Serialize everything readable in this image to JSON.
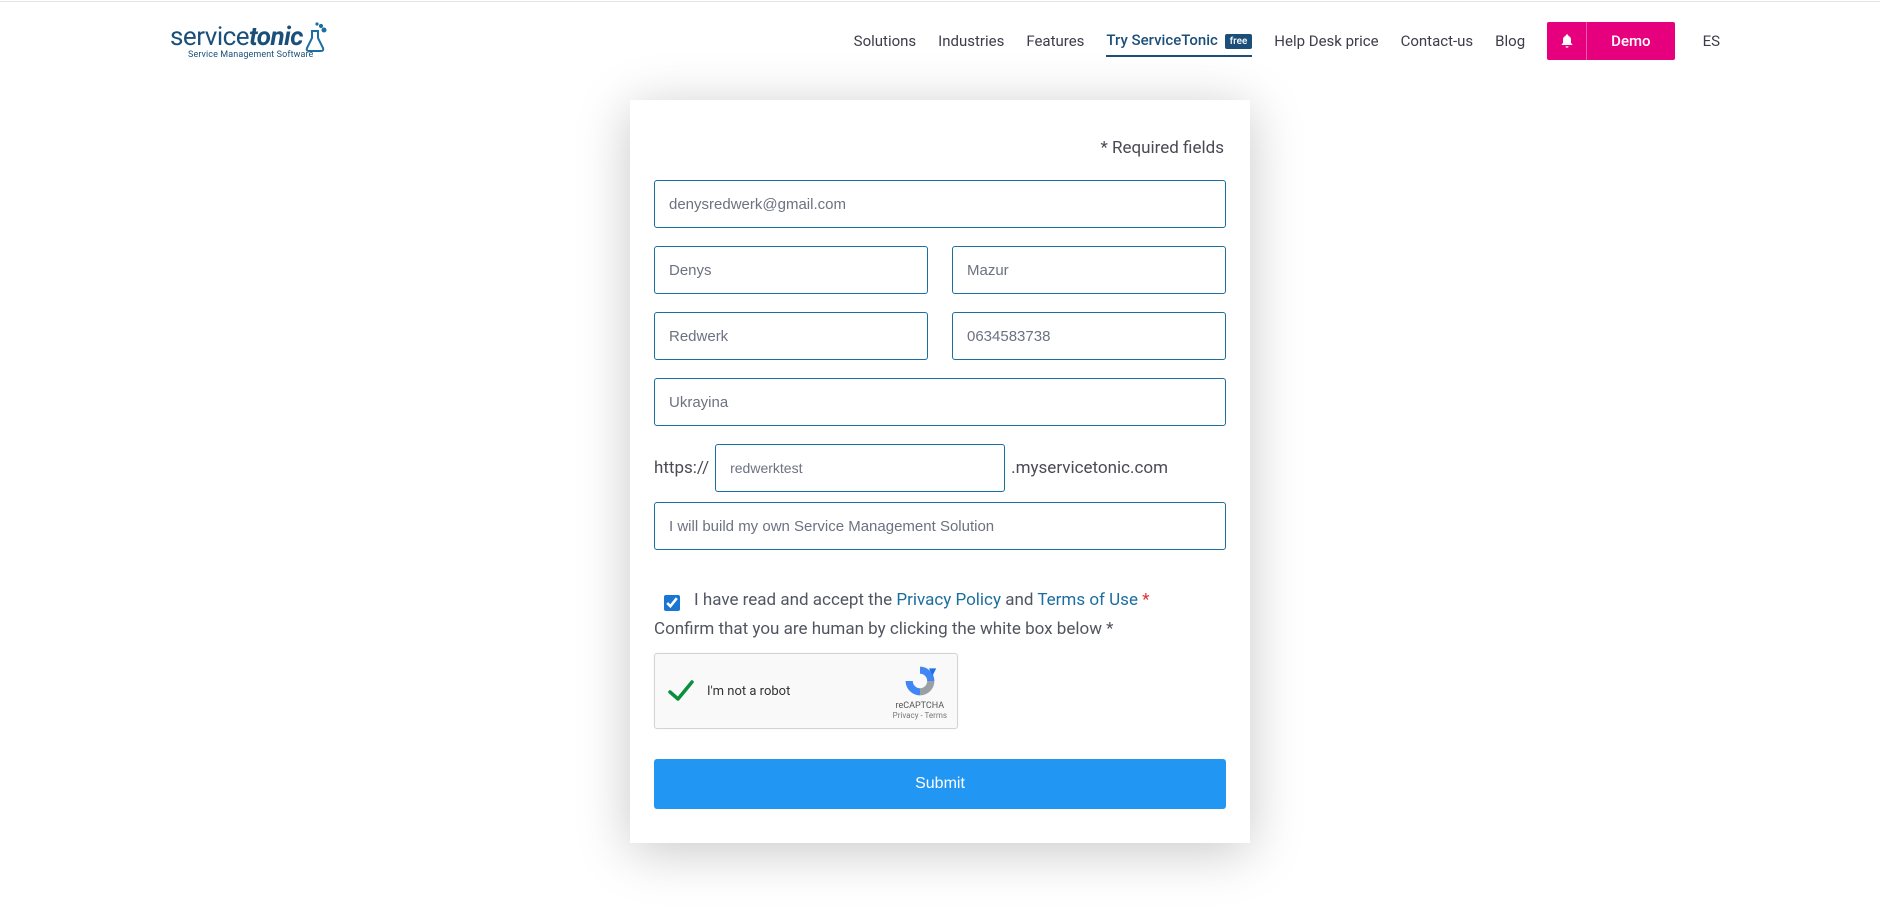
{
  "logo": {
    "brand_main_a": "service",
    "brand_main_b": "tonic",
    "tagline": "Service Management Software"
  },
  "nav": {
    "solutions": "Solutions",
    "industries": "Industries",
    "features": "Features",
    "try": "Try ServiceTonic",
    "try_badge": "free",
    "helpdesk": "Help Desk price",
    "contact": "Contact-us",
    "blog": "Blog",
    "demo": "Demo",
    "lang": "ES"
  },
  "form": {
    "required_note": "* Required fields",
    "email": "denysredwerk@gmail.com",
    "first_name": "Denys",
    "last_name": "Mazur",
    "company": "Redwerk",
    "phone": "0634583738",
    "country": "Ukrayina",
    "url_prefix": "https://",
    "subdomain": "redwerktest",
    "url_suffix": ".myservicetonic.com",
    "plan": "I will build my own Service Management Solution",
    "consent_pre": "I have read and accept the ",
    "privacy": "Privacy Policy",
    "consent_and": " and ",
    "terms": "Terms of Use",
    "consent_ast": " *",
    "captcha_note": "Confirm that you are human by clicking the white box below *",
    "recaptcha_label": "I'm not a robot",
    "recaptcha_brand": "reCAPTCHA",
    "recaptcha_pt": "Privacy - Terms",
    "submit": "Submit"
  }
}
